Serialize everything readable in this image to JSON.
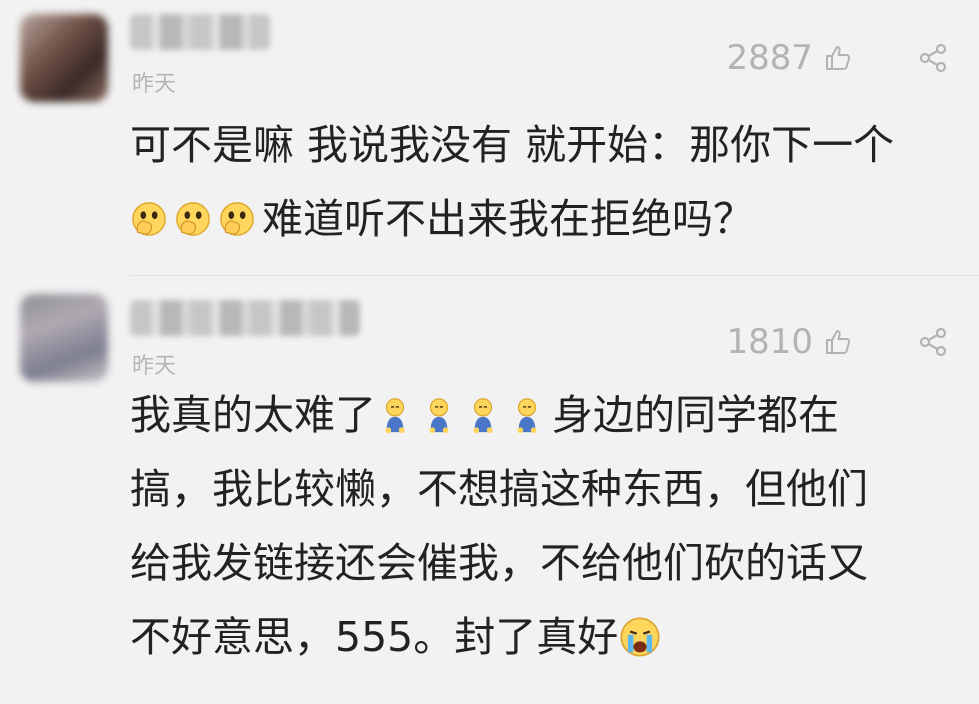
{
  "comments": [
    {
      "time": "昨天",
      "likes": "2887",
      "text_line1": "可不是嘛 我说我没有 就开始：那你下一个",
      "text_line2": "难道听不出来我在拒绝吗？",
      "emoji_name": "hand-thinking-emoji"
    },
    {
      "time": "昨天",
      "likes": "1810",
      "text_part1": "我真的太难了",
      "text_part2": "身边的同学都在",
      "text_line2": "搞，我比较懒，不想搞这种东西，但他们",
      "text_line3": "给我发链接还会催我，不给他们砍的话又",
      "text_line4": "不好意思，555。封了真好",
      "emoji_name": "kneeling-sad-emoji",
      "end_emoji_name": "crying-emoji"
    }
  ],
  "colors": {
    "background": "#f2f2f2",
    "text": "#222222",
    "meta": "#b3b3b3"
  }
}
